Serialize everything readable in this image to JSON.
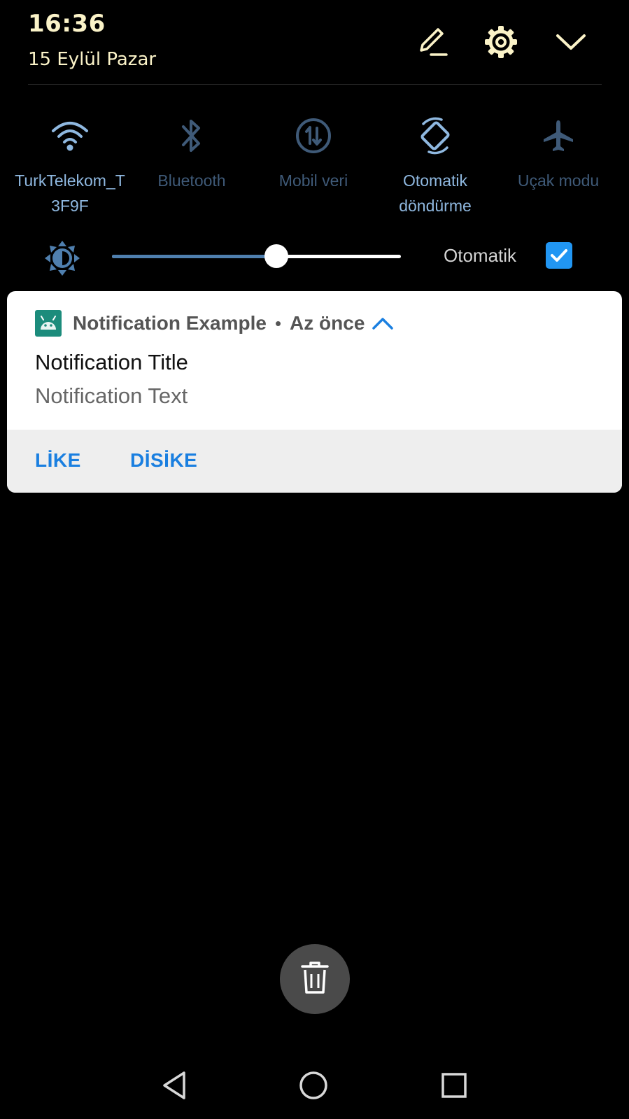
{
  "status": {
    "time": "16:36",
    "date": "15 Eylül Pazar"
  },
  "header_icons": [
    "edit-icon",
    "settings-icon",
    "collapse-icon"
  ],
  "quick_settings": {
    "tiles": [
      {
        "label_line1": "TurkTelekom_T",
        "label_line2": "3F9F",
        "icon": "wifi-icon",
        "state": "on"
      },
      {
        "label_line1": "Bluetooth",
        "label_line2": "",
        "icon": "bluetooth-icon",
        "state": "off"
      },
      {
        "label_line1": "Mobil veri",
        "label_line2": "",
        "icon": "mobile-data-icon",
        "state": "off"
      },
      {
        "label_line1": "Otomatik",
        "label_line2": "döndürme",
        "icon": "auto-rotate-icon",
        "state": "on"
      },
      {
        "label_line1": "Uçak modu",
        "label_line2": "",
        "icon": "airplane-icon",
        "state": "off"
      }
    ]
  },
  "brightness": {
    "level_percent": 57,
    "auto_label": "Otomatik",
    "auto_checked": true
  },
  "notification": {
    "app_name": "Notification Example",
    "separator": "•",
    "when": "Az önce",
    "title": "Notification Title",
    "text": "Notification Text",
    "actions": [
      "LİKE",
      "DİSİKE"
    ]
  },
  "colors": {
    "clock_text": "#fbf3c8",
    "tile_on": "#8fb8e0",
    "tile_off": "#3f5a78",
    "accent": "#2196f3",
    "action_text": "#1a7fe0",
    "app_icon_bg": "#1c8c7c"
  },
  "bottom": {
    "clear_all_icon": "trash-icon",
    "nav": [
      "back-icon",
      "home-icon",
      "recents-icon"
    ]
  }
}
